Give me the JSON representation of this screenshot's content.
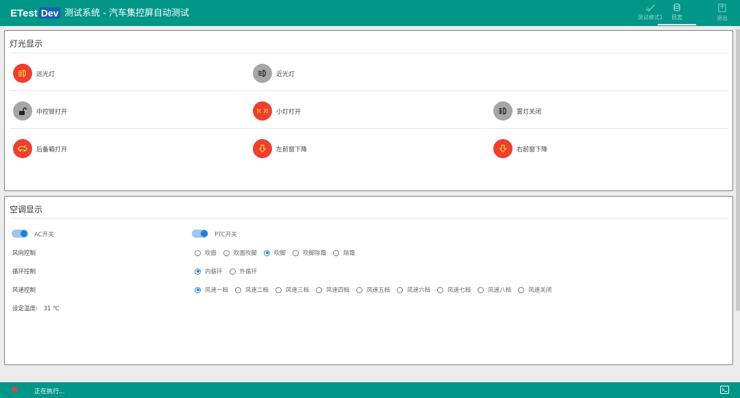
{
  "header": {
    "logo_main": "ETest",
    "logo_badge": "Dev",
    "title": "测试系统 - 汽车集控屏自动测试",
    "actions": [
      {
        "label": "测试模式1",
        "icon": "brush-check-icon"
      },
      {
        "label": "日志",
        "icon": "database-icon"
      },
      {
        "label": "退出",
        "icon": "exit-icon"
      }
    ]
  },
  "lights_panel": {
    "title": "灯光显示",
    "items": [
      {
        "label": "远光灯",
        "icon": "high-beam-icon",
        "state_color": "#f03e2f"
      },
      {
        "label": "近光灯",
        "icon": "low-beam-icon",
        "state_color": "#a6a6a6"
      },
      {
        "label": "中控锁打开",
        "icon": "unlock-icon",
        "state_color": "#a6a6a6"
      },
      {
        "label": "小灯打开",
        "icon": "side-light-icon",
        "state_color": "#f03e2f"
      },
      {
        "label": "雾灯关闭",
        "icon": "fog-light-icon",
        "state_color": "#a6a6a6"
      },
      {
        "label": "后备箱打开",
        "icon": "trunk-car-icon",
        "state_color": "#f03e2f"
      },
      {
        "label": "左前窗下降",
        "icon": "arrow-down-icon",
        "state_color": "#f03e2f"
      },
      {
        "label": "右前窗下降",
        "icon": "arrow-down-icon",
        "state_color": "#f03e2f"
      }
    ]
  },
  "ac_panel": {
    "title": "空调显示",
    "ac_switch": {
      "label": "AC开关",
      "on": true
    },
    "ptc_switch": {
      "label": "PTC开关",
      "on": true
    },
    "wind_direction": {
      "label": "风向控制",
      "options": [
        "吹面",
        "吹面吹脚",
        "吹脚",
        "吹脚除霜",
        "除霜"
      ],
      "selected": "吹脚"
    },
    "circulation": {
      "label": "循环控制",
      "options": [
        "内循环",
        "外循环"
      ],
      "selected": "内循环"
    },
    "fan_speed": {
      "label": "风速控制",
      "options": [
        "风速一档",
        "风速二档",
        "风速三档",
        "风速四档",
        "风速五档",
        "风速六档",
        "风速七档",
        "风速八档",
        "风速关闭"
      ],
      "selected": "风速一档"
    },
    "temperature": {
      "label": "设定温度:",
      "value": "31 ℃"
    }
  },
  "status_bar": {
    "text": "正在执行...",
    "accent": "#009688"
  }
}
